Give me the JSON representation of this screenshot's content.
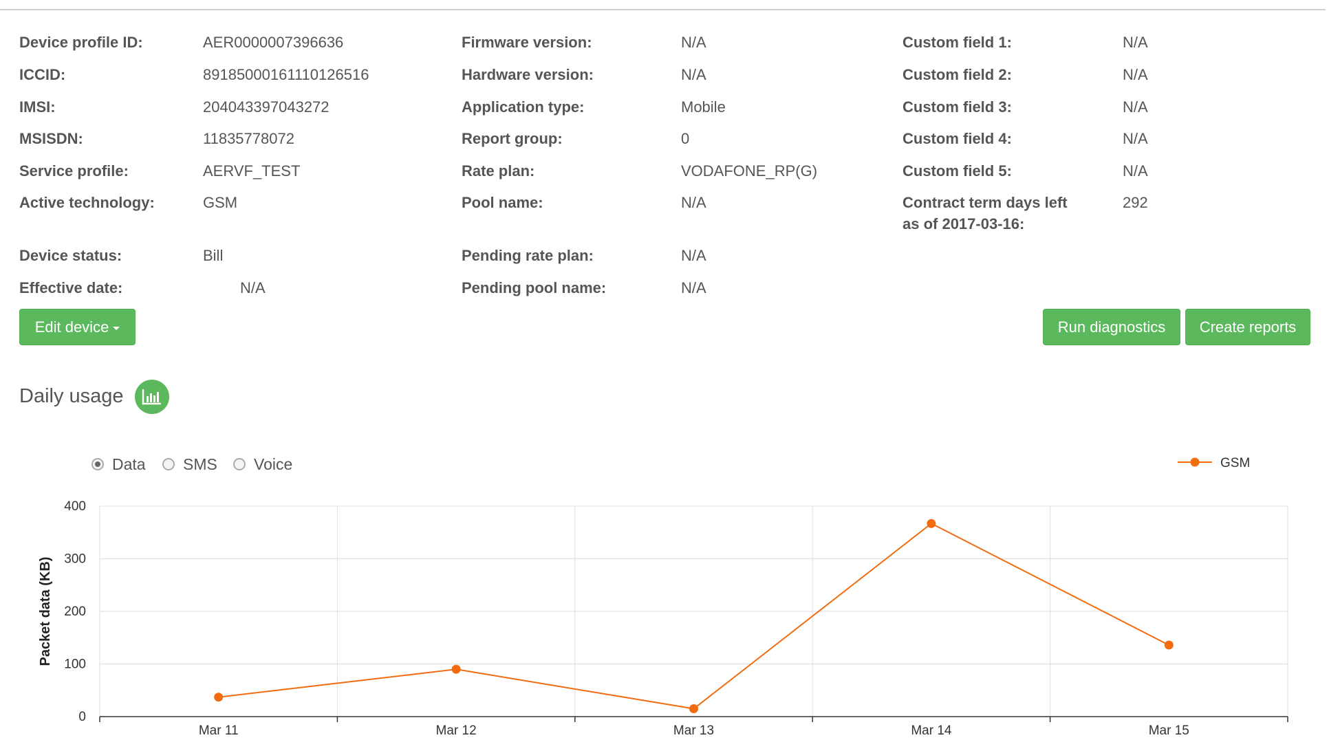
{
  "details": {
    "col1": [
      {
        "label": "Device profile ID:",
        "value": "AER0000007396636"
      },
      {
        "label": "ICCID:",
        "value": "89185000161110126516"
      },
      {
        "label": "IMSI:",
        "value": "204043397043272"
      },
      {
        "label": "MSISDN:",
        "value": "11835778072"
      },
      {
        "label": "Service profile:",
        "value": "AERVF_TEST"
      },
      {
        "label": "Active technology:",
        "value": "GSM"
      },
      {
        "label": "Device status:",
        "value": "Bill"
      },
      {
        "label": "Effective date:",
        "value": "N/A"
      }
    ],
    "col2": [
      {
        "label": "Firmware version:",
        "value": "N/A"
      },
      {
        "label": "Hardware version:",
        "value": "N/A"
      },
      {
        "label": "Application type:",
        "value": "Mobile"
      },
      {
        "label": "Report group:",
        "value": "0"
      },
      {
        "label": "Rate plan:",
        "value": "VODAFONE_RP(G)"
      },
      {
        "label": "Pool name:",
        "value": "N/A"
      },
      {
        "label": "Pending rate plan:",
        "value": "N/A"
      },
      {
        "label": "Pending pool name:",
        "value": "N/A"
      }
    ],
    "col3": [
      {
        "label": "Custom field 1:",
        "value": "N/A"
      },
      {
        "label": "Custom field 2:",
        "value": "N/A"
      },
      {
        "label": "Custom field 3:",
        "value": "N/A"
      },
      {
        "label": "Custom field 4:",
        "value": "N/A"
      },
      {
        "label": "Custom field 5:",
        "value": "N/A"
      },
      {
        "label": "Contract term days left",
        "label2": "as of 2017-03-16:",
        "value": "292"
      }
    ]
  },
  "buttons": {
    "edit_device": "Edit device",
    "run_diagnostics": "Run diagnostics",
    "create_reports": "Create reports"
  },
  "usage": {
    "title": "Daily usage",
    "icon": "bar-chart-icon",
    "options": [
      {
        "label": "Data",
        "selected": true
      },
      {
        "label": "SMS",
        "selected": false
      },
      {
        "label": "Voice",
        "selected": false
      }
    ]
  },
  "colors": {
    "accent": "#5cb85c",
    "series": "#f26b0f",
    "grid": "#dddddd"
  },
  "chart_data": {
    "type": "line",
    "categories": [
      "Mar 11",
      "Mar 12",
      "Mar 13",
      "Mar 14",
      "Mar 15"
    ],
    "series": [
      {
        "name": "GSM",
        "values": [
          37,
          90,
          15,
          367,
          136
        ]
      }
    ],
    "ylabel": "Packet data (KB)",
    "xlabel": "",
    "ylim": [
      0,
      400
    ],
    "yticks": [
      0,
      100,
      200,
      300,
      400
    ],
    "grid": true,
    "legend_position": "top-right"
  }
}
